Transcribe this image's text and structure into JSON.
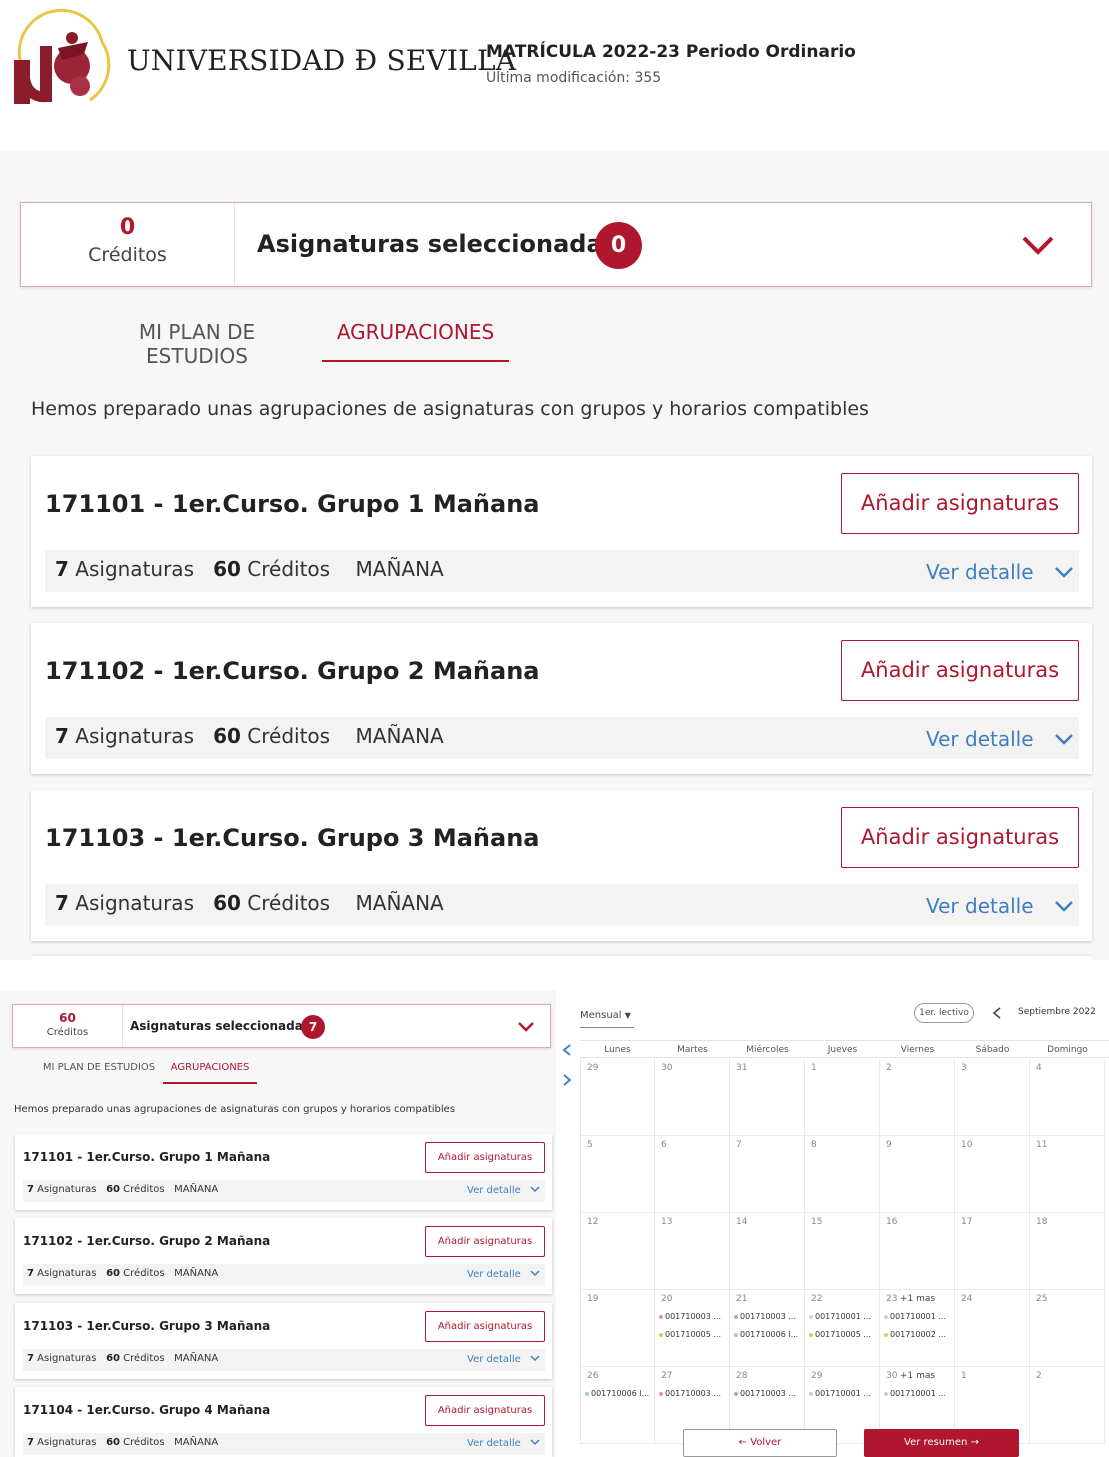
{
  "header": {
    "university": "UNIVERSIDAD Ð SEVILLA",
    "logo_text": "UNIVERSIDAD DE SEVILLA",
    "enrollment_title": "MATRÍCULA 2022-23 Periodo Ordinario",
    "last_modified": "Última modificación: 355"
  },
  "top": {
    "credits_value": "0",
    "credits_label": "Créditos",
    "selected_title": "Asignaturas seleccionadas",
    "selected_count": "0",
    "tabs": [
      "MI PLAN DE ESTUDIOS",
      "AGRUPACIONES"
    ],
    "active_tab": "AGRUPACIONES",
    "description": "Hemos preparado unas agrupaciones de asignaturas con grupos y horarios compatibles",
    "groups": [
      {
        "title": "171101 - 1er.Curso. Grupo 1 Mañana",
        "add": "Añadir asignaturas",
        "subjects_num": "7",
        "subjects_label": "Asignaturas",
        "credits_num": "60",
        "credits_label": "Créditos",
        "shift": "MAÑANA",
        "detail": "Ver detalle"
      },
      {
        "title": "171102 - 1er.Curso. Grupo 2 Mañana",
        "add": "Añadir asignaturas",
        "subjects_num": "7",
        "subjects_label": "Asignaturas",
        "credits_num": "60",
        "credits_label": "Créditos",
        "shift": "MAÑANA",
        "detail": "Ver detalle"
      },
      {
        "title": "171103 - 1er.Curso. Grupo 3 Mañana",
        "add": "Añadir asignaturas",
        "subjects_num": "7",
        "subjects_label": "Asignaturas",
        "credits_num": "60",
        "credits_label": "Créditos",
        "shift": "MAÑANA",
        "detail": "Ver detalle"
      }
    ]
  },
  "bottom": {
    "credits_value": "60",
    "credits_label": "Créditos",
    "selected_title": "Asignaturas seleccionadas",
    "selected_count": "7",
    "tabs": [
      "MI PLAN DE ESTUDIOS",
      "AGRUPACIONES"
    ],
    "description": "Hemos preparado unas agrupaciones de asignaturas con grupos y horarios compatibles",
    "groups": [
      {
        "title": "171101 - 1er.Curso. Grupo 1 Mañana",
        "add": "Añadir asignaturas",
        "subjects_num": "7",
        "subjects_label": "Asignaturas",
        "credits_num": "60",
        "credits_label": "Créditos",
        "shift": "MAÑANA",
        "detail": "Ver detalle"
      },
      {
        "title": "171102 - 1er.Curso. Grupo 2 Mañana",
        "add": "Añadir asignaturas",
        "subjects_num": "7",
        "subjects_label": "Asignaturas",
        "credits_num": "60",
        "credits_label": "Créditos",
        "shift": "MAÑANA",
        "detail": "Ver detalle"
      },
      {
        "title": "171103 - 1er.Curso. Grupo 3 Mañana",
        "add": "Añadir asignaturas",
        "subjects_num": "7",
        "subjects_label": "Asignaturas",
        "credits_num": "60",
        "credits_label": "Créditos",
        "shift": "MAÑANA",
        "detail": "Ver detalle"
      },
      {
        "title": "171104 - 1er.Curso. Grupo 4 Mañana",
        "add": "Añadir asignaturas",
        "subjects_num": "7",
        "subjects_label": "Asignaturas",
        "credits_num": "60",
        "credits_label": "Créditos",
        "shift": "MAÑANA",
        "detail": "Ver detalle"
      }
    ]
  },
  "calendar": {
    "view_select": "Mensual",
    "period_button": "1er. lectivo",
    "month": "Septiembre 2022",
    "weekdays": [
      "Lunes",
      "Martes",
      "Miércoles",
      "Jueves",
      "Viernes",
      "Sábado",
      "Domingo"
    ],
    "weeks": [
      [
        "29",
        "30",
        "31",
        "1",
        "2",
        "3",
        "4"
      ],
      [
        "5",
        "6",
        "7",
        "8",
        "9",
        "10",
        "11"
      ],
      [
        "12",
        "13",
        "14",
        "15",
        "16",
        "17",
        "18"
      ],
      [
        "19",
        "20",
        "21",
        "22",
        "23",
        "24",
        "25"
      ],
      [
        "26",
        "27",
        "28",
        "29",
        "30",
        "1",
        "2"
      ]
    ],
    "more_label": "+1 mas",
    "week4_events": [
      [],
      [
        {
          "text": "001710003 ...",
          "color": "#e58cb3"
        },
        {
          "text": "001710005 ...",
          "color": "#e3c85a"
        }
      ],
      [
        {
          "text": "001710003 ...",
          "color": "#e58cb3"
        },
        {
          "text": "001710006 l...",
          "color": "#9ccbe0"
        }
      ],
      [
        {
          "text": "001710001 ...",
          "color": "#cfcfcf"
        },
        {
          "text": "001710005 ...",
          "color": "#e3c85a"
        }
      ],
      [
        {
          "text": "001710001 ...",
          "color": "#cfcfcf"
        },
        {
          "text": "001710002 ...",
          "color": "#e3c85a"
        }
      ]
    ],
    "week5_events": [
      {
        "text": "001710006 l...",
        "color": "#9ccbe0"
      },
      {
        "text": "001710003 ...",
        "color": "#e58cb3"
      },
      {
        "text": "001710003 ...",
        "color": "#e58cb3"
      },
      {
        "text": "001710001 ...",
        "color": "#cfcfcf"
      },
      {
        "text": "001710001 ...",
        "color": "#cfcfcf"
      }
    ],
    "back_button": "Volver",
    "summary_button": "Ver resumen"
  },
  "colors": {
    "accent": "#b0162d",
    "link": "#3f7fbf"
  }
}
